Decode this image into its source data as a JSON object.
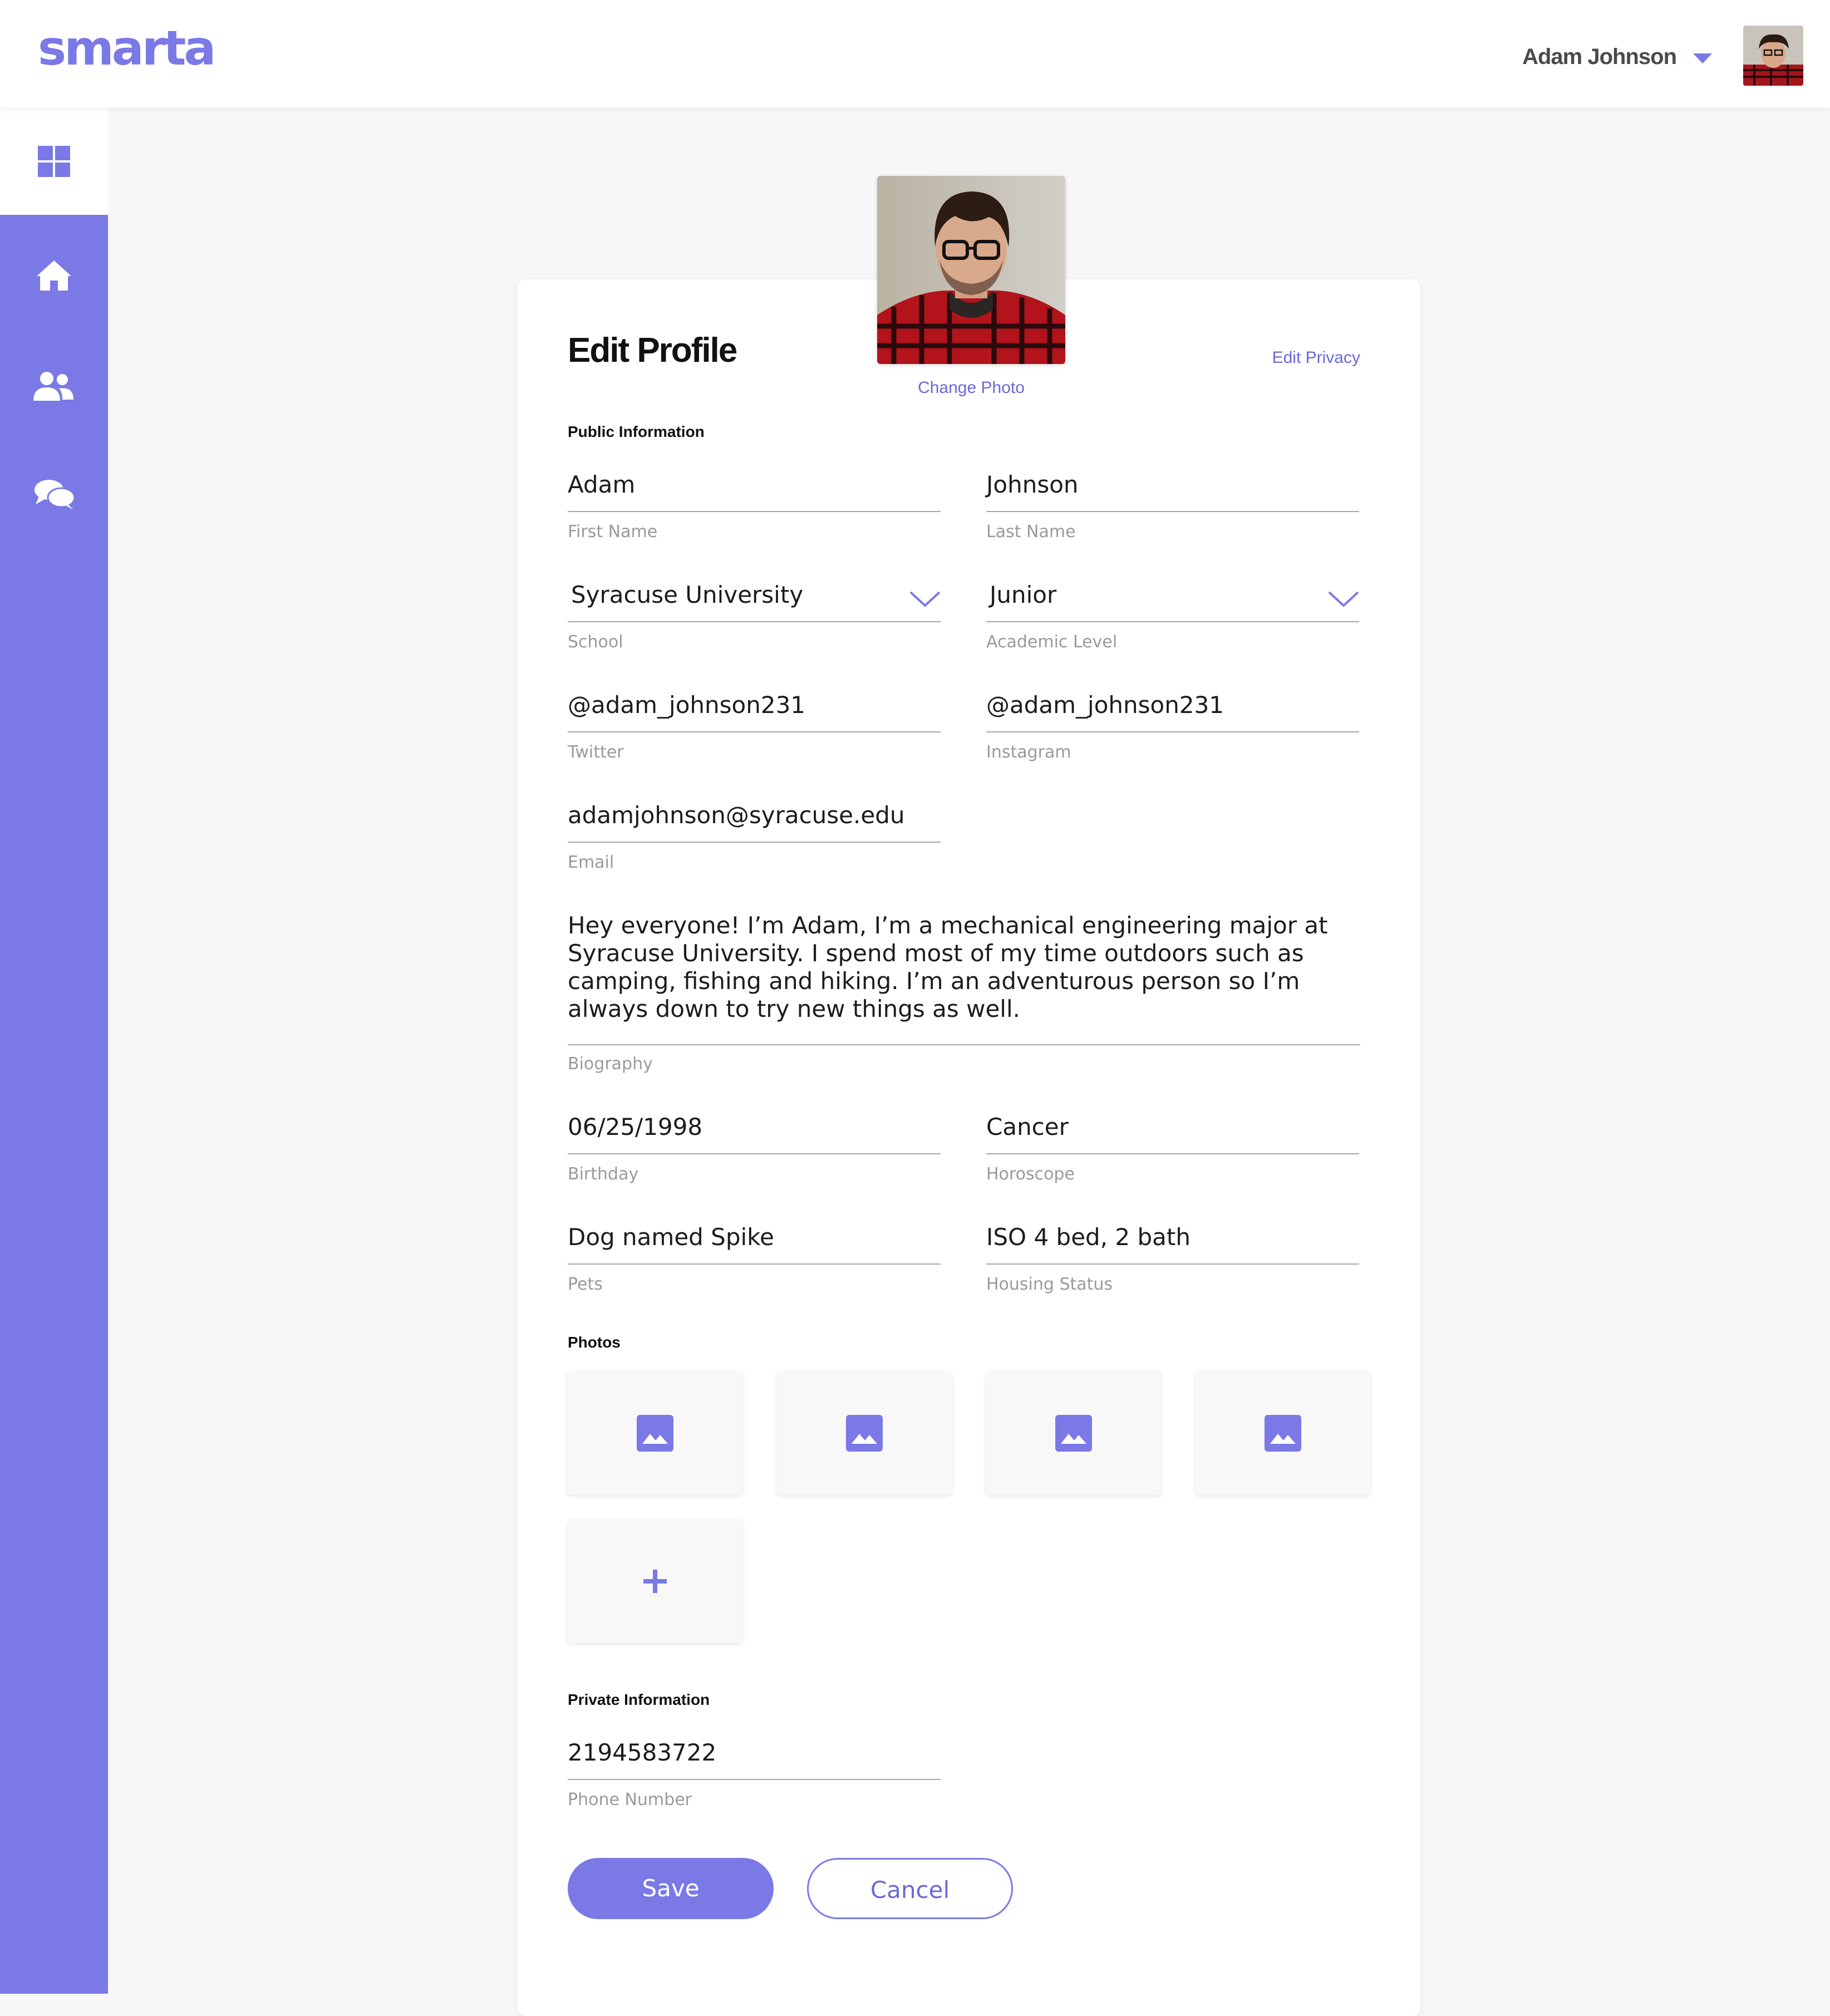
{
  "app": {
    "logo": "smarta"
  },
  "header": {
    "user_name": "Adam Johnson"
  },
  "sidebar": {
    "items": [
      {
        "name": "dashboard",
        "icon": "grid-icon"
      },
      {
        "name": "home",
        "icon": "home-icon"
      },
      {
        "name": "friends",
        "icon": "users-icon"
      },
      {
        "name": "messages",
        "icon": "chat-icon"
      }
    ]
  },
  "profile": {
    "title": "Edit Profile",
    "change_photo": "Change Photo",
    "edit_privacy": "Edit Privacy",
    "public_section": "Public Information",
    "first_name": {
      "value": "Adam",
      "label": "First Name"
    },
    "last_name": {
      "value": "Johnson",
      "label": "Last Name"
    },
    "school": {
      "value": "Syracuse University",
      "label": "School"
    },
    "academic_level": {
      "value": "Junior",
      "label": "Academic Level"
    },
    "twitter": {
      "value": "@adam_johnson231",
      "label": "Twitter"
    },
    "instagram": {
      "value": "@adam_johnson231",
      "label": "Instagram"
    },
    "email": {
      "value": "adamjohnson@syracuse.edu",
      "label": "Email"
    },
    "biography": {
      "value": "Hey everyone! I’m Adam, I’m a mechanical engineering major at Syracuse University. I spend most of my time outdoors such as camping, fishing and hiking. I’m an adventurous person so I’m always down to try new things as well.",
      "label": "Biography"
    },
    "birthday": {
      "value": "06/25/1998",
      "label": "Birthday"
    },
    "horoscope": {
      "value": "Cancer",
      "label": "Horoscope"
    },
    "pets": {
      "value": "Dog named Spike",
      "label": "Pets"
    },
    "housing": {
      "value": "ISO 4 bed, 2 bath",
      "label": "Housing Status"
    },
    "photos_section": "Photos",
    "private_section": "Private Information",
    "phone": {
      "value": "2194583722",
      "label": "Phone Number"
    },
    "save_label": "Save",
    "cancel_label": "Cancel"
  },
  "colors": {
    "accent": "#7a79e6",
    "link": "#6a69d6",
    "background": "#f7f7f7"
  }
}
